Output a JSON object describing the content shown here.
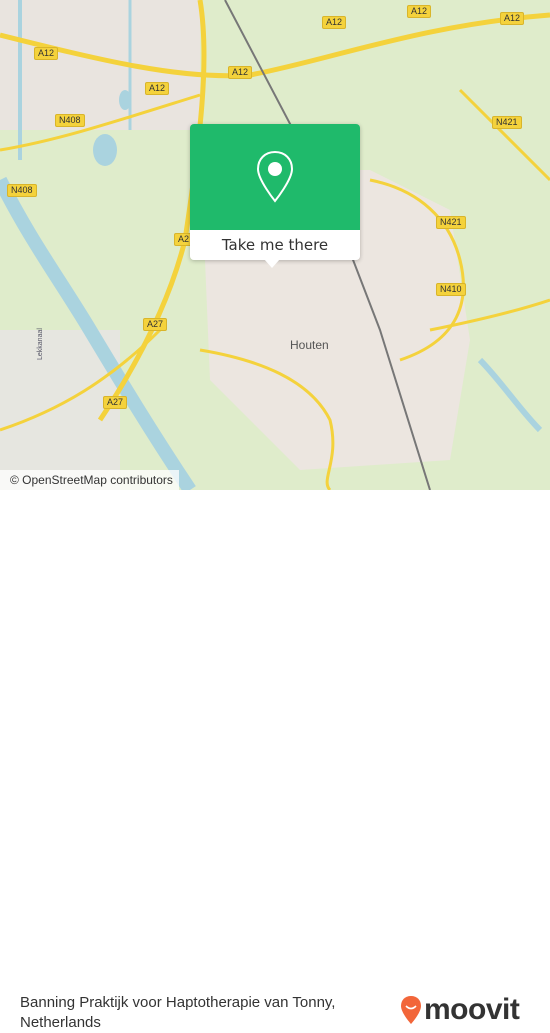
{
  "map": {
    "road_labels": [
      "A12",
      "A12",
      "A12",
      "A12",
      "A12",
      "N408",
      "N408",
      "A27",
      "A27",
      "A2",
      "N421",
      "N421",
      "N410"
    ],
    "place_label": "Houten",
    "canal_label": "Lekkanaal",
    "attribution": "© OpenStreetMap contributors"
  },
  "popup": {
    "button_label": "Take me there",
    "icon": "map-pin-icon",
    "color": "#1fba6b"
  },
  "footer": {
    "location_name": "Banning Praktijk voor Haptotherapie van Tonny, Netherlands",
    "brand": "moovit",
    "brand_color": "#f2663a"
  }
}
